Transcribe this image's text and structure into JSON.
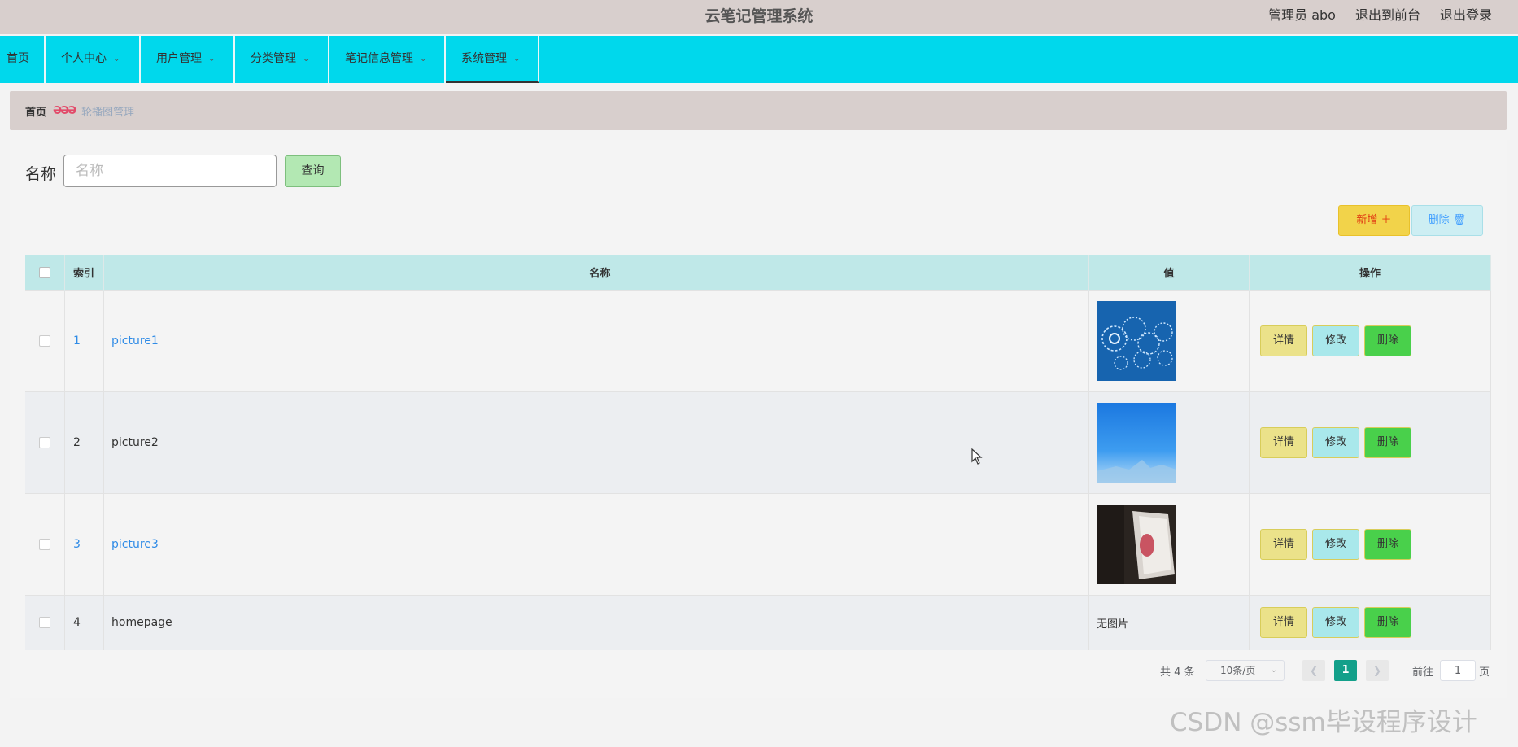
{
  "header": {
    "title": "云笔记管理系统",
    "user": "管理员 abo",
    "back_to_front": "退出到前台",
    "logout": "退出登录"
  },
  "nav": {
    "items": [
      {
        "label": "首页"
      },
      {
        "label": "个人中心"
      },
      {
        "label": "用户管理"
      },
      {
        "label": "分类管理"
      },
      {
        "label": "笔记信息管理"
      },
      {
        "label": "系统管理"
      }
    ]
  },
  "breadcrumb": {
    "home": "首页",
    "current": "轮播图管理"
  },
  "search": {
    "label": "名称",
    "placeholder": "名称",
    "button": "查询"
  },
  "toolbar": {
    "add_label": "新增 ＋",
    "delete_label": "删除 🗑"
  },
  "table": {
    "columns": [
      "索引",
      "名称",
      "值",
      "操作"
    ],
    "rows": [
      {
        "index": "1",
        "name": "picture1",
        "value": "",
        "image": "gears"
      },
      {
        "index": "2",
        "name": "picture2",
        "value": "",
        "image": "sky"
      },
      {
        "index": "3",
        "name": "picture3",
        "value": "",
        "image": "photo"
      },
      {
        "index": "4",
        "name": "homepage",
        "value": "无图片",
        "image": ""
      }
    ],
    "actions": {
      "detail": "详情",
      "edit": "修改",
      "delete": "删除"
    }
  },
  "pagination": {
    "total": "共 4 条",
    "page_size": "10条/页",
    "current_page": "1",
    "goto_label": "前往",
    "goto_value": "1",
    "page_suffix": "页"
  },
  "watermark": "CSDN @ssm毕设程序设计",
  "colors": {
    "nav_bg": "#00d8ec",
    "header_bg": "#d8cfcd",
    "table_header_bg": "#bfe8e8",
    "pager_active": "#13a08a"
  }
}
